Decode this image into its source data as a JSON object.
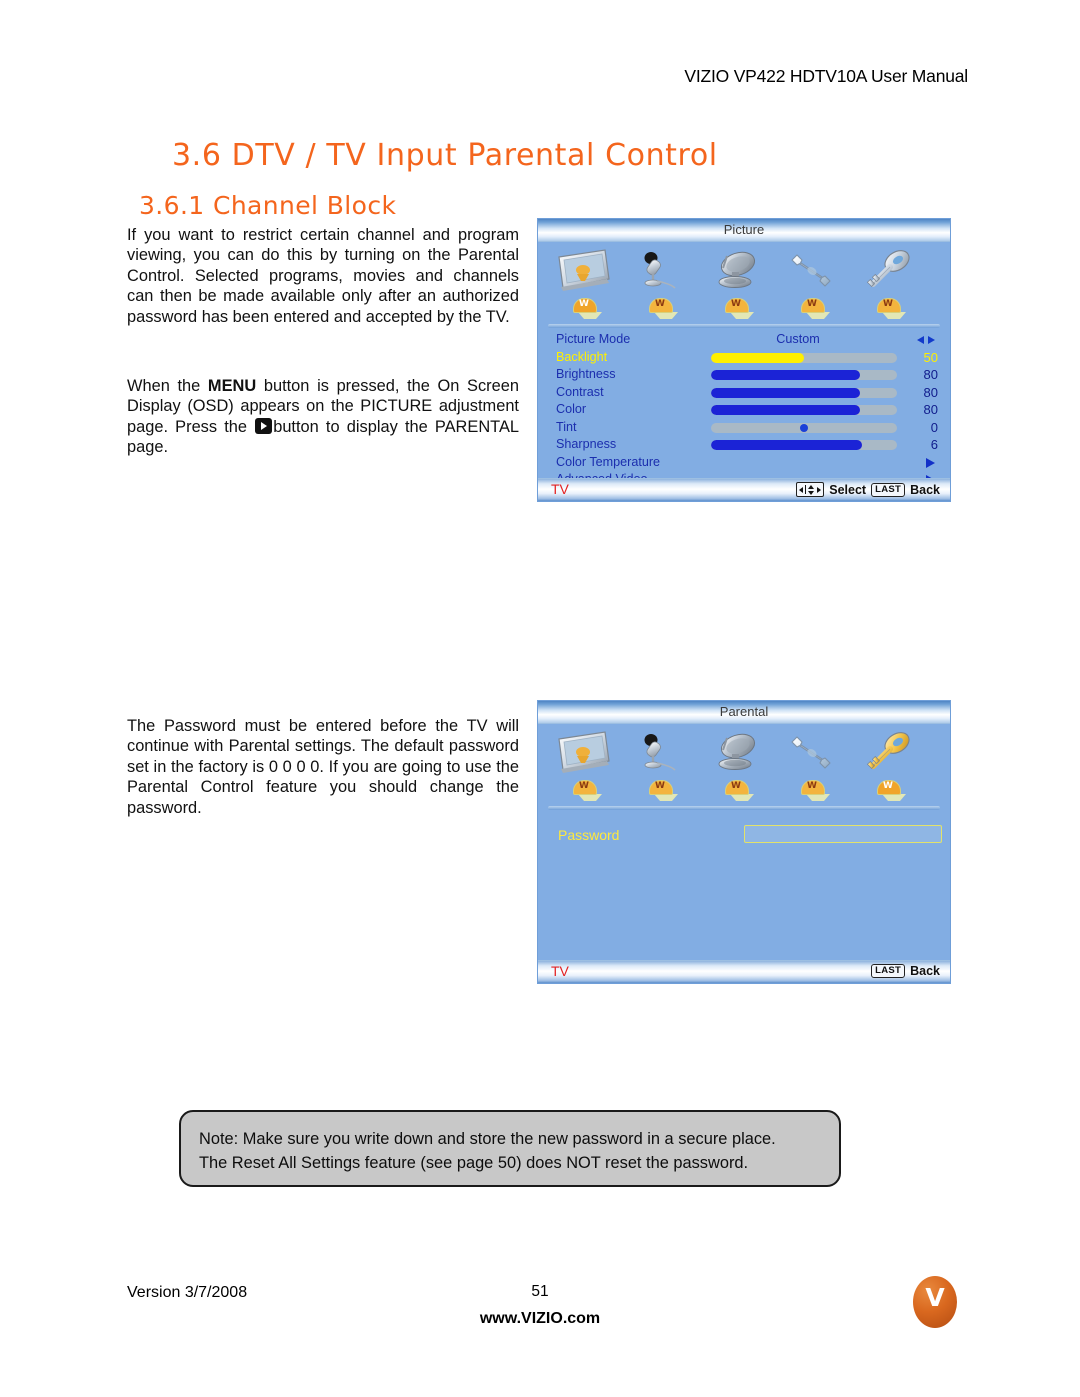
{
  "header": {
    "running_head": "VIZIO VP422 HDTV10A User Manual"
  },
  "headings": {
    "section": "3.6 DTV / TV Input Parental Control",
    "subsection": "3.6.1 Channel Block",
    "accent_color": "#F4651D"
  },
  "body": {
    "intro": "If you want to restrict certain channel and program viewing, you can do this by turning on the Parental Control.  Selected programs, movies and channels can then be made available only after an authorized password has been entered and accepted by the TV.",
    "menu_part1": "When the ",
    "menu_bold": "MENU",
    "menu_part2": " button is pressed, the On Screen Display (OSD) appears on the PICTURE adjustment page.  Press the ",
    "menu_part3": "button to display the PARENTAL page.",
    "password_note": "The Password must be entered before the TV will continue with Parental settings.   The default password set in the factory is 0 0 0 0.  If you are going to use the Parental Control feature you should change the password."
  },
  "osd_picture": {
    "title": "Picture",
    "tabs": [
      {
        "name": "picture-tab",
        "icon": "monitor-icon",
        "selected": true
      },
      {
        "name": "audio-tab",
        "icon": "microphone-icon",
        "selected": false
      },
      {
        "name": "tuner-tab",
        "icon": "satellite-dish-icon",
        "selected": false
      },
      {
        "name": "setup-tab",
        "icon": "wrench-icon",
        "selected": false
      },
      {
        "name": "parental-tab",
        "icon": "key-icon",
        "selected": false
      }
    ],
    "rows": [
      {
        "label": "Picture Mode",
        "type": "value",
        "value": "Custom",
        "control": "left-right-arrows"
      },
      {
        "label": "Backlight",
        "type": "slider",
        "value": "50",
        "percent": 50,
        "fill_color": "#FFF000",
        "highlighted": true
      },
      {
        "label": "Brightness",
        "type": "slider",
        "value": "80",
        "percent": 80,
        "fill_color": "#1B23D6",
        "highlighted": false
      },
      {
        "label": "Contrast",
        "type": "slider",
        "value": "80",
        "percent": 80,
        "fill_color": "#1B23D6",
        "highlighted": false
      },
      {
        "label": "Color",
        "type": "slider",
        "value": "80",
        "percent": 80,
        "fill_color": "#1B23D6",
        "highlighted": false
      },
      {
        "label": "Tint",
        "type": "knob",
        "value": "0",
        "percent": 50,
        "highlighted": false
      },
      {
        "label": "Sharpness",
        "type": "slider",
        "value": "6",
        "percent": 81,
        "fill_color": "#1B23D6",
        "highlighted": false
      },
      {
        "label": "Color Temperature",
        "type": "submenu",
        "control": "right-arrow"
      },
      {
        "label": "Advanced Video",
        "type": "submenu",
        "control": "right-arrow"
      }
    ],
    "footer": {
      "source": "TV",
      "select_label": "Select",
      "last_key": "LAST",
      "back_label": "Back"
    }
  },
  "osd_parental": {
    "title": "Parental",
    "tabs": [
      {
        "name": "picture-tab",
        "icon": "monitor-icon",
        "selected": false
      },
      {
        "name": "audio-tab",
        "icon": "microphone-icon",
        "selected": false
      },
      {
        "name": "tuner-tab",
        "icon": "satellite-dish-icon",
        "selected": false
      },
      {
        "name": "setup-tab",
        "icon": "wrench-icon",
        "selected": false
      },
      {
        "name": "parental-tab",
        "icon": "key-icon",
        "selected": true
      }
    ],
    "password_label": "Password",
    "password_value": "",
    "footer": {
      "source": "TV",
      "last_key": "LAST",
      "back_label": "Back"
    }
  },
  "note": {
    "line1": "Note: Make sure you write down and store the new password in a secure place.",
    "line2": "The Reset All Settings feature (see page 50) does NOT reset the password."
  },
  "footer": {
    "version": "Version 3/7/2008",
    "page_number": "51",
    "url": "www.VIZIO.com",
    "logo_letter": "V"
  }
}
